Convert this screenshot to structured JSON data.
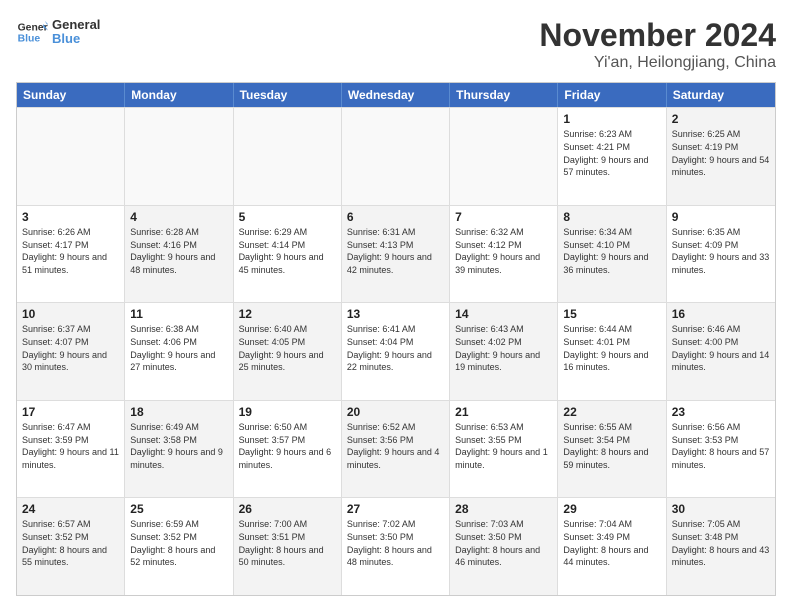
{
  "logo": {
    "line1": "General",
    "line2": "Blue"
  },
  "title": "November 2024",
  "subtitle": "Yi'an, Heilongjiang, China",
  "days_of_week": [
    "Sunday",
    "Monday",
    "Tuesday",
    "Wednesday",
    "Thursday",
    "Friday",
    "Saturday"
  ],
  "weeks": [
    [
      {
        "day": "",
        "info": "",
        "shaded": true
      },
      {
        "day": "",
        "info": "",
        "shaded": true
      },
      {
        "day": "",
        "info": "",
        "shaded": true
      },
      {
        "day": "",
        "info": "",
        "shaded": true
      },
      {
        "day": "",
        "info": "",
        "shaded": true
      },
      {
        "day": "1",
        "info": "Sunrise: 6:23 AM\nSunset: 4:21 PM\nDaylight: 9 hours and 57 minutes.",
        "shaded": false
      },
      {
        "day": "2",
        "info": "Sunrise: 6:25 AM\nSunset: 4:19 PM\nDaylight: 9 hours and 54 minutes.",
        "shaded": true
      }
    ],
    [
      {
        "day": "3",
        "info": "Sunrise: 6:26 AM\nSunset: 4:17 PM\nDaylight: 9 hours and 51 minutes.",
        "shaded": false
      },
      {
        "day": "4",
        "info": "Sunrise: 6:28 AM\nSunset: 4:16 PM\nDaylight: 9 hours and 48 minutes.",
        "shaded": true
      },
      {
        "day": "5",
        "info": "Sunrise: 6:29 AM\nSunset: 4:14 PM\nDaylight: 9 hours and 45 minutes.",
        "shaded": false
      },
      {
        "day": "6",
        "info": "Sunrise: 6:31 AM\nSunset: 4:13 PM\nDaylight: 9 hours and 42 minutes.",
        "shaded": true
      },
      {
        "day": "7",
        "info": "Sunrise: 6:32 AM\nSunset: 4:12 PM\nDaylight: 9 hours and 39 minutes.",
        "shaded": false
      },
      {
        "day": "8",
        "info": "Sunrise: 6:34 AM\nSunset: 4:10 PM\nDaylight: 9 hours and 36 minutes.",
        "shaded": true
      },
      {
        "day": "9",
        "info": "Sunrise: 6:35 AM\nSunset: 4:09 PM\nDaylight: 9 hours and 33 minutes.",
        "shaded": false
      }
    ],
    [
      {
        "day": "10",
        "info": "Sunrise: 6:37 AM\nSunset: 4:07 PM\nDaylight: 9 hours and 30 minutes.",
        "shaded": true
      },
      {
        "day": "11",
        "info": "Sunrise: 6:38 AM\nSunset: 4:06 PM\nDaylight: 9 hours and 27 minutes.",
        "shaded": false
      },
      {
        "day": "12",
        "info": "Sunrise: 6:40 AM\nSunset: 4:05 PM\nDaylight: 9 hours and 25 minutes.",
        "shaded": true
      },
      {
        "day": "13",
        "info": "Sunrise: 6:41 AM\nSunset: 4:04 PM\nDaylight: 9 hours and 22 minutes.",
        "shaded": false
      },
      {
        "day": "14",
        "info": "Sunrise: 6:43 AM\nSunset: 4:02 PM\nDaylight: 9 hours and 19 minutes.",
        "shaded": true
      },
      {
        "day": "15",
        "info": "Sunrise: 6:44 AM\nSunset: 4:01 PM\nDaylight: 9 hours and 16 minutes.",
        "shaded": false
      },
      {
        "day": "16",
        "info": "Sunrise: 6:46 AM\nSunset: 4:00 PM\nDaylight: 9 hours and 14 minutes.",
        "shaded": true
      }
    ],
    [
      {
        "day": "17",
        "info": "Sunrise: 6:47 AM\nSunset: 3:59 PM\nDaylight: 9 hours and 11 minutes.",
        "shaded": false
      },
      {
        "day": "18",
        "info": "Sunrise: 6:49 AM\nSunset: 3:58 PM\nDaylight: 9 hours and 9 minutes.",
        "shaded": true
      },
      {
        "day": "19",
        "info": "Sunrise: 6:50 AM\nSunset: 3:57 PM\nDaylight: 9 hours and 6 minutes.",
        "shaded": false
      },
      {
        "day": "20",
        "info": "Sunrise: 6:52 AM\nSunset: 3:56 PM\nDaylight: 9 hours and 4 minutes.",
        "shaded": true
      },
      {
        "day": "21",
        "info": "Sunrise: 6:53 AM\nSunset: 3:55 PM\nDaylight: 9 hours and 1 minute.",
        "shaded": false
      },
      {
        "day": "22",
        "info": "Sunrise: 6:55 AM\nSunset: 3:54 PM\nDaylight: 8 hours and 59 minutes.",
        "shaded": true
      },
      {
        "day": "23",
        "info": "Sunrise: 6:56 AM\nSunset: 3:53 PM\nDaylight: 8 hours and 57 minutes.",
        "shaded": false
      }
    ],
    [
      {
        "day": "24",
        "info": "Sunrise: 6:57 AM\nSunset: 3:52 PM\nDaylight: 8 hours and 55 minutes.",
        "shaded": true
      },
      {
        "day": "25",
        "info": "Sunrise: 6:59 AM\nSunset: 3:52 PM\nDaylight: 8 hours and 52 minutes.",
        "shaded": false
      },
      {
        "day": "26",
        "info": "Sunrise: 7:00 AM\nSunset: 3:51 PM\nDaylight: 8 hours and 50 minutes.",
        "shaded": true
      },
      {
        "day": "27",
        "info": "Sunrise: 7:02 AM\nSunset: 3:50 PM\nDaylight: 8 hours and 48 minutes.",
        "shaded": false
      },
      {
        "day": "28",
        "info": "Sunrise: 7:03 AM\nSunset: 3:50 PM\nDaylight: 8 hours and 46 minutes.",
        "shaded": true
      },
      {
        "day": "29",
        "info": "Sunrise: 7:04 AM\nSunset: 3:49 PM\nDaylight: 8 hours and 44 minutes.",
        "shaded": false
      },
      {
        "day": "30",
        "info": "Sunrise: 7:05 AM\nSunset: 3:48 PM\nDaylight: 8 hours and 43 minutes.",
        "shaded": true
      }
    ]
  ]
}
